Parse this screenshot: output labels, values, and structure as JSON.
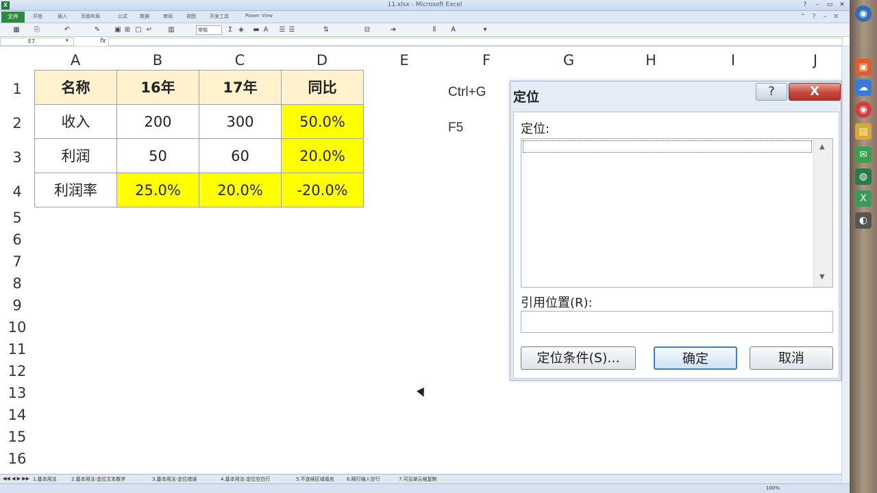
{
  "window": {
    "title": "11.xlsx - Microsoft Excel",
    "logo": "X",
    "controls": [
      "?",
      "–",
      "▭",
      "✕"
    ]
  },
  "ribbon": {
    "file_tab": "文件",
    "tabs": [
      "开始",
      "插入",
      "页面布局",
      "公式",
      "数据",
      "审阅",
      "视图",
      "开发工具",
      "Power View"
    ]
  },
  "toolbar": {
    "number_format": "常规"
  },
  "formula_bar": {
    "name_box": "E7",
    "fx": "fx",
    "formula": ""
  },
  "grid": {
    "columns": [
      "A",
      "B",
      "C",
      "D",
      "E",
      "F",
      "G",
      "H",
      "I",
      "J"
    ],
    "rows": [
      "1",
      "2",
      "3",
      "4",
      "5",
      "6",
      "7",
      "8",
      "9",
      "10",
      "11",
      "12",
      "13",
      "14",
      "15",
      "16"
    ],
    "table": {
      "header": [
        "名称",
        "16年",
        "17年",
        "同比"
      ],
      "rows": [
        [
          "收入",
          "200",
          "300",
          "50.0%"
        ],
        [
          "利润",
          "50",
          "60",
          "20.0%"
        ],
        [
          "利润率",
          "25.0%",
          "20.0%",
          "-20.0%"
        ]
      ]
    },
    "notes": [
      "Ctrl+G",
      "F5"
    ]
  },
  "dialog": {
    "title": "定位",
    "help": "?",
    "close": "X",
    "goto_label": "定位:",
    "reference_label": "引用位置(R):",
    "reference_value": "",
    "special_button": "定位条件(S)...",
    "ok_button": "确定",
    "cancel_button": "取消"
  },
  "sheets": [
    "1.基本用法",
    "2.基本用法-定位文本数字",
    "3.基本用法-定位错误",
    "4.基本用法-定位空白行",
    "5.不连续区域填充",
    "6.隔行插入空行",
    "7.可见单元格复制"
  ],
  "status": {
    "zoom": "100%"
  },
  "colors": {
    "header_fill": "#fff2cc",
    "highlight_fill": "#ffff00",
    "file_tab": "#2a8a3e",
    "dialog_bg": "#e4ecf6",
    "close_button": "#c7463a"
  }
}
